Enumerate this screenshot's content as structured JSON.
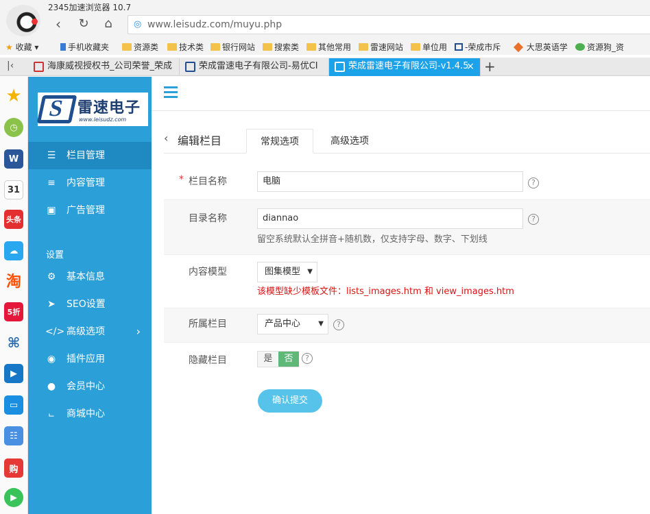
{
  "browser": {
    "app_title": "2345加速浏览器 10.7",
    "url": "www.leisudz.com/muyu.php",
    "bookmarks": [
      "收藏",
      "手机收藏夹",
      "资源类",
      "技术类",
      "银行网站",
      "搜索类",
      "其他常用",
      "雷速网站",
      "单位用",
      "-荣成市斥",
      "大思英语学",
      "资源狗_资"
    ],
    "tabs": [
      {
        "label": "海康威视授权书_公司荣誉_荣成"
      },
      {
        "label": "荣成雷速电子有限公司-易优CI"
      },
      {
        "label": "荣成雷速电子有限公司-v1.4.5"
      }
    ],
    "tab_close": "×",
    "tab_add": "+"
  },
  "dock": {
    "apps": [
      "star",
      "clock",
      "word",
      "31",
      "头条",
      "weather",
      "淘",
      "5折",
      "game",
      "video",
      "monitor",
      "calc",
      "购",
      "play"
    ]
  },
  "logo": {
    "text": "雷速电子",
    "url": "www.leisudz.com"
  },
  "sidebar": {
    "menu": [
      {
        "label": "栏目管理",
        "icon": "sitemap-icon"
      },
      {
        "label": "内容管理",
        "icon": "list-icon"
      },
      {
        "label": "广告管理",
        "icon": "image-icon"
      }
    ],
    "settings_label": "设置",
    "settings": [
      {
        "label": "基本信息",
        "icon": "gear-icon"
      },
      {
        "label": "SEO设置",
        "icon": "paper-plane-icon"
      },
      {
        "label": "高级选项",
        "icon": "code-icon"
      },
      {
        "label": "插件应用",
        "icon": "ball-icon"
      },
      {
        "label": "会员中心",
        "icon": "user-icon"
      },
      {
        "label": "商城中心",
        "icon": "cart-icon"
      }
    ]
  },
  "page": {
    "title": "编辑栏目",
    "tabs": [
      "常规选项",
      "高级选项"
    ]
  },
  "form": {
    "name_label": "栏目名称",
    "name_value": "电脑",
    "dir_label": "目录名称",
    "dir_value": "diannao",
    "dir_hint": "留空系统默认全拼音+随机数，仅支持字母、数字、下划线",
    "model_label": "内容模型",
    "model_value": "图集模型",
    "model_error": "该模型缺少模板文件：lists_images.htm 和 view_images.htm",
    "parent_label": "所属栏目",
    "parent_value": "产品中心",
    "hidden_label": "隐藏栏目",
    "hidden_yes": "是",
    "hidden_no": "否",
    "required_mark": "*",
    "help_mark": "?",
    "submit": "确认提交"
  },
  "colors": {
    "sidebar": "#2b9fd7",
    "accent": "#1ca2e8",
    "error": "#dd1111",
    "toggle_on": "#5fb878"
  }
}
